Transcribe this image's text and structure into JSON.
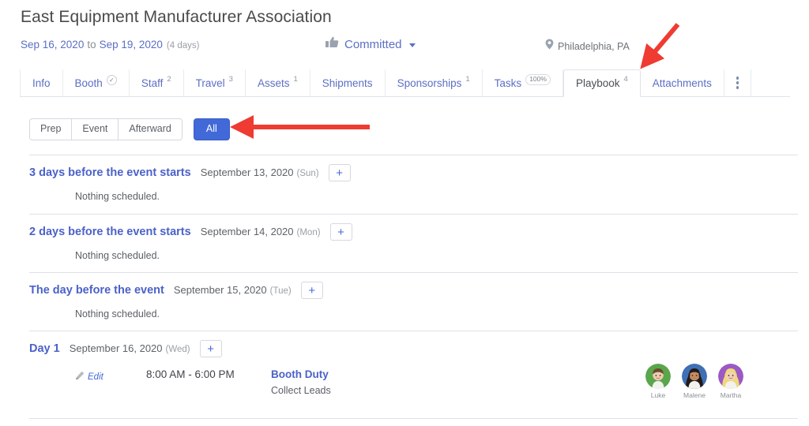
{
  "header": {
    "title": "East Equipment Manufacturer Association",
    "date_start": "Sep 16, 2020",
    "date_separator": "to",
    "date_end": "Sep 19, 2020",
    "duration": "(4 days)",
    "status_label": "Committed",
    "status_icon": "thumbs-up-icon",
    "status_color": "#5b6fc4",
    "location": "Philadelphia, PA",
    "location_icon": "map-pin-icon"
  },
  "tabs": [
    {
      "label": "Info",
      "badge": "",
      "badge_type": "none",
      "active": false
    },
    {
      "label": "Booth",
      "badge": "✓",
      "badge_type": "check",
      "active": false
    },
    {
      "label": "Staff",
      "badge": "2",
      "badge_type": "sup",
      "active": false
    },
    {
      "label": "Travel",
      "badge": "3",
      "badge_type": "sup",
      "active": false
    },
    {
      "label": "Assets",
      "badge": "1",
      "badge_type": "sup",
      "active": false
    },
    {
      "label": "Shipments",
      "badge": "",
      "badge_type": "none",
      "active": false
    },
    {
      "label": "Sponsorships",
      "badge": "1",
      "badge_type": "sup",
      "active": false
    },
    {
      "label": "Tasks",
      "badge": "100%",
      "badge_type": "pill",
      "active": false
    },
    {
      "label": "Playbook",
      "badge": "4",
      "badge_type": "sup",
      "active": true
    },
    {
      "label": "Attachments",
      "badge": "",
      "badge_type": "none",
      "active": false
    }
  ],
  "tab_overflow_icon": "kebab-menu-icon",
  "filters": {
    "segments": [
      "Prep",
      "Event",
      "Afterward"
    ],
    "all_label": "All",
    "active": "All",
    "active_color": "#4169d8"
  },
  "sections": [
    {
      "title": "3 days before the event starts",
      "date": "September 13, 2020",
      "dow": "(Sun)",
      "add_label": "+",
      "empty_text": "Nothing scheduled.",
      "entries": []
    },
    {
      "title": "2 days before the event starts",
      "date": "September 14, 2020",
      "dow": "(Mon)",
      "add_label": "+",
      "empty_text": "Nothing scheduled.",
      "entries": []
    },
    {
      "title": "The day before the event",
      "date": "September 15, 2020",
      "dow": "(Tue)",
      "add_label": "+",
      "empty_text": "Nothing scheduled.",
      "entries": []
    },
    {
      "title": "Day 1",
      "date": "September 16, 2020",
      "dow": "(Wed)",
      "add_label": "+",
      "empty_text": "",
      "entries": [
        {
          "edit_label": "Edit",
          "edit_icon": "pencil-icon",
          "time": "8:00 AM - 6:00 PM",
          "name": "Booth Duty",
          "subtitle": "Collect Leads",
          "people": [
            {
              "name": "Luke",
              "bg": "#5aa64b",
              "skin": "#f0cbb0",
              "hair": "#6b4b2f",
              "hair_style": "short"
            },
            {
              "name": "Malene",
              "bg": "#3f6fb5",
              "skin": "#c78b62",
              "hair": "#231a16",
              "hair_style": "long"
            },
            {
              "name": "Martha",
              "bg": "#9b59c4",
              "skin": "#f3d2b8",
              "hair": "#f0d97a",
              "hair_style": "long"
            }
          ]
        }
      ]
    }
  ],
  "annotations": [
    {
      "name": "arrow-playbook-tab",
      "color": "#ef3b32",
      "direction": "down-left"
    },
    {
      "name": "arrow-all-filter",
      "color": "#ef3b32",
      "direction": "left"
    }
  ]
}
